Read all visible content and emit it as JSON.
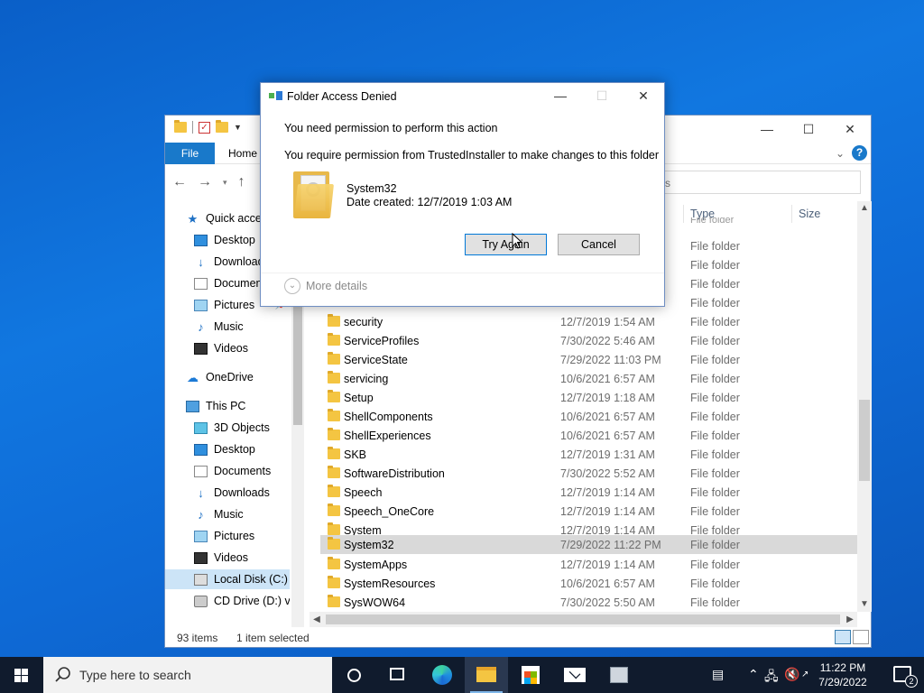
{
  "explorer": {
    "ribbon": {
      "file_tab": "File",
      "home_tab": "Home"
    },
    "search_placeholder": "s",
    "sidebar": [
      {
        "label": "Quick access",
        "icon": "star-icon",
        "top": 0
      },
      {
        "label": "Desktop",
        "icon": "desktop-icon",
        "pinned": false
      },
      {
        "label": "Downloads",
        "icon": "downloads-icon"
      },
      {
        "label": "Documents",
        "icon": "documents-icon"
      },
      {
        "label": "Pictures",
        "icon": "pictures-icon",
        "pinned": true
      },
      {
        "label": "Music",
        "icon": "music-icon"
      },
      {
        "label": "Videos",
        "icon": "videos-icon"
      },
      {
        "label": "OneDrive",
        "icon": "onedrive-icon"
      },
      {
        "label": "This PC",
        "icon": "this-pc-icon"
      },
      {
        "label": "3D Objects",
        "icon": "3d-objects-icon"
      },
      {
        "label": "Desktop",
        "icon": "desktop-icon"
      },
      {
        "label": "Documents",
        "icon": "documents-icon"
      },
      {
        "label": "Downloads",
        "icon": "downloads-icon"
      },
      {
        "label": "Music",
        "icon": "music-icon"
      },
      {
        "label": "Pictures",
        "icon": "pictures-icon"
      },
      {
        "label": "Videos",
        "icon": "videos-icon"
      },
      {
        "label": "Local Disk (C:)",
        "icon": "local-disk-icon",
        "selected": true
      },
      {
        "label": "CD Drive (D:) virt",
        "icon": "cd-drive-icon"
      }
    ],
    "columns": {
      "type": "Type",
      "size": "Size"
    },
    "ghost_row_type": "File folder",
    "rows": [
      {
        "name": "security",
        "date": "12/7/2019 1:54 AM",
        "type": "File folder"
      },
      {
        "name": "ServiceProfiles",
        "date": "7/30/2022 5:46 AM",
        "type": "File folder"
      },
      {
        "name": "ServiceState",
        "date": "7/29/2022 11:03 PM",
        "type": "File folder"
      },
      {
        "name": "servicing",
        "date": "10/6/2021 6:57 AM",
        "type": "File folder"
      },
      {
        "name": "Setup",
        "date": "12/7/2019 1:18 AM",
        "type": "File folder"
      },
      {
        "name": "ShellComponents",
        "date": "10/6/2021 6:57 AM",
        "type": "File folder"
      },
      {
        "name": "ShellExperiences",
        "date": "10/6/2021 6:57 AM",
        "type": "File folder"
      },
      {
        "name": "SKB",
        "date": "12/7/2019 1:31 AM",
        "type": "File folder"
      },
      {
        "name": "SoftwareDistribution",
        "date": "7/30/2022 5:52 AM",
        "type": "File folder"
      },
      {
        "name": "Speech",
        "date": "12/7/2019 1:14 AM",
        "type": "File folder"
      },
      {
        "name": "Speech_OneCore",
        "date": "12/7/2019 1:14 AM",
        "type": "File folder"
      },
      {
        "name": "System",
        "date": "12/7/2019 1:14 AM",
        "type": "File folder"
      },
      {
        "name": "System32",
        "date": "7/29/2022 11:22 PM",
        "type": "File folder",
        "selected": true
      },
      {
        "name": "SystemApps",
        "date": "12/7/2019 1:14 AM",
        "type": "File folder"
      },
      {
        "name": "SystemResources",
        "date": "10/6/2021 6:57 AM",
        "type": "File folder"
      },
      {
        "name": "SysWOW64",
        "date": "7/30/2022 5:50 AM",
        "type": "File folder"
      }
    ],
    "above_rows_types": [
      "File folder",
      "File folder",
      "File folder",
      "File folder"
    ],
    "status": {
      "items": "93 items",
      "selected": "1 item selected"
    }
  },
  "dialog": {
    "title": "Folder Access Denied",
    "message1": "You need permission to perform this action",
    "message2": "You require permission from TrustedInstaller to make changes to this folder",
    "folder_name": "System32",
    "folder_date": "Date created: 12/7/2019 1:03 AM",
    "try_again": "Try Again",
    "cancel": "Cancel",
    "more_details": "More details"
  },
  "taskbar": {
    "search_placeholder": "Type here to search",
    "time": "11:22 PM",
    "date": "7/29/2022",
    "notification_count": "2"
  }
}
